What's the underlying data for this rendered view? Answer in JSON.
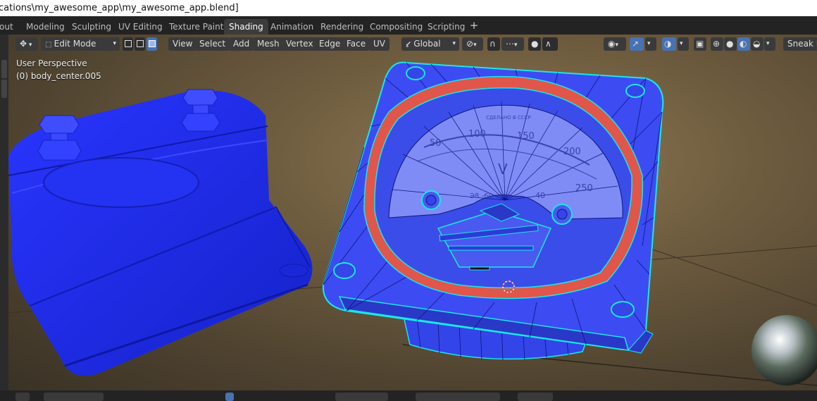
{
  "window": {
    "title": "cations\\my_awesome_app\\my_awesome_app.blend]"
  },
  "workspaces": {
    "tabs": [
      "out",
      "Modeling",
      "Sculpting",
      "UV Editing",
      "Texture Paint",
      "Shading",
      "Animation",
      "Rendering",
      "Compositing",
      "Scripting"
    ],
    "active": "Shading",
    "add_label": "+"
  },
  "header": {
    "mode": "Edit Mode",
    "menus": [
      "View",
      "Select",
      "Add",
      "Mesh",
      "Vertex",
      "Edge",
      "Face",
      "UV"
    ],
    "transform_orientation": "Global",
    "active_select_mode": "face",
    "snap_label": "Sneak I"
  },
  "viewport": {
    "view_name": "User Perspective",
    "object_name": "(0) body_center.005",
    "dial": {
      "scale_labels": [
        "50",
        "100",
        "150",
        "200",
        "250",
        "40"
      ],
      "unit": "V",
      "maker_text": "СДЕЛАНО В СССР",
      "class_text": "Э8 -60"
    },
    "colors": {
      "mesh_blue": "#1f2ef0",
      "selected_edge": "#19e8e8",
      "seam_red": "#e0564a",
      "background": "#6e5c3f"
    }
  }
}
